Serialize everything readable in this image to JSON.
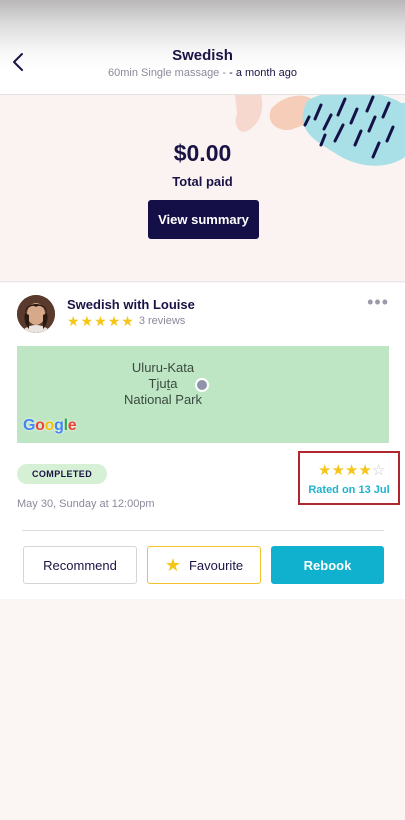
{
  "header": {
    "title": "Swedish",
    "subtitle_details": "60min Single massage -",
    "subtitle_time": "- a month ago"
  },
  "payment": {
    "amount": "$0.00",
    "label": "Total paid",
    "view_summary_label": "View summary"
  },
  "booking": {
    "therapist_title": "Swedish with Louise",
    "therapist_rating": 5,
    "reviews_text": "3 reviews",
    "more_label": "•••",
    "map": {
      "place_line1": "Uluru-Kata",
      "place_line2": "Tjuṯa",
      "place_line3": "National Park",
      "provider": [
        "G",
        "o",
        "o",
        "g",
        "l",
        "e"
      ]
    },
    "status": "COMPLETED",
    "date": "May 30, Sunday at 12:00pm",
    "user_rating": 4,
    "user_rating_max": 5,
    "rated_on": "Rated on 13 Jul"
  },
  "actions": {
    "recommend": "Recommend",
    "favourite": "Favourite",
    "rebook": "Rebook"
  },
  "colors": {
    "navy": "#1a1446",
    "button_dark": "#140f47",
    "accent_teal": "#10b1cf",
    "star_yellow": "#f5c518",
    "completed_bg": "#d5f0d4",
    "highlight_red": "#b0262e"
  }
}
